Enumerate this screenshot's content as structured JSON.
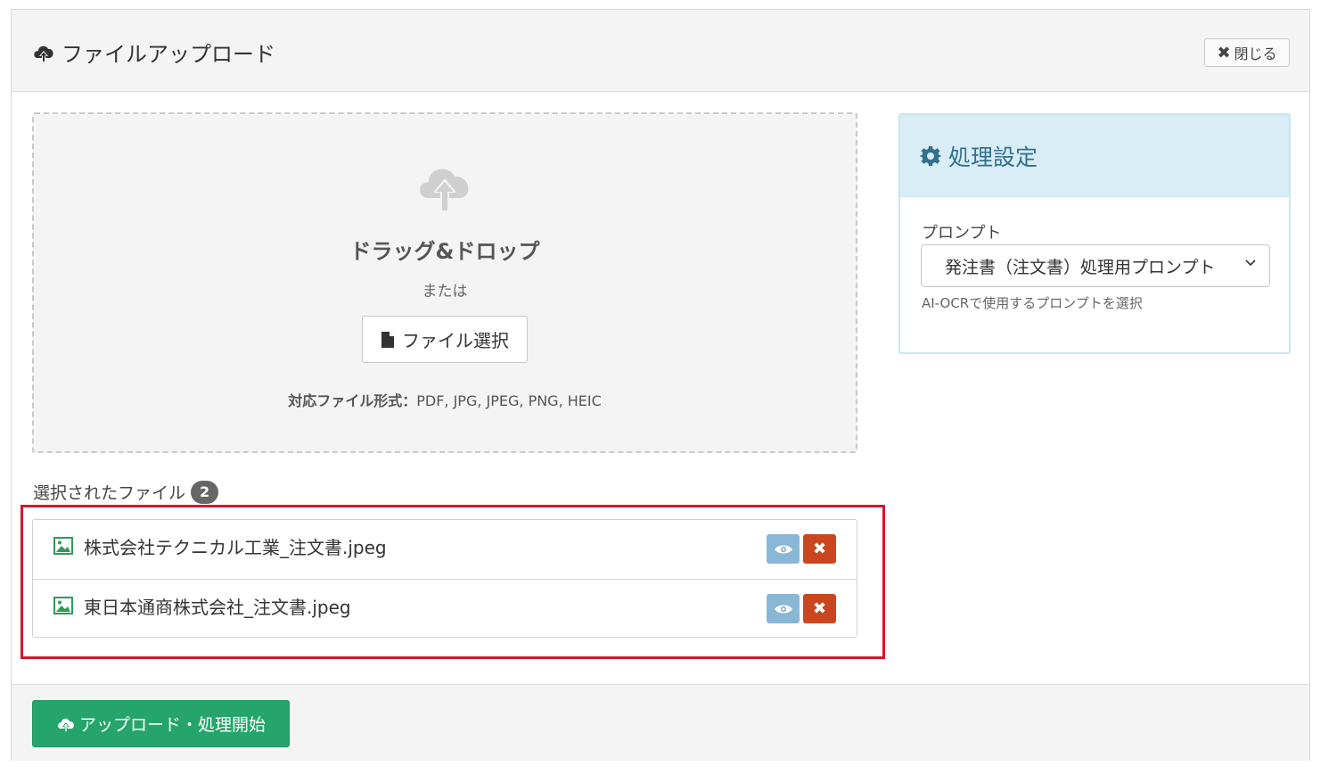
{
  "modal": {
    "title": "ファイルアップロード",
    "close_label": "閉じる"
  },
  "dropzone": {
    "title": "ドラッグ&ドロップ",
    "or_text": "または",
    "file_button_label": "ファイル選択",
    "formats_label": "対応ファイル形式：",
    "formats_value": "PDF, JPG, JPEG, PNG, HEIC"
  },
  "settings": {
    "title": "処理設定",
    "prompt_label": "プロンプト",
    "prompt_selected": "発注書（注文書）処理用プロンプト",
    "prompt_help": "AI-OCRで使用するプロンプトを選択"
  },
  "selected_files": {
    "label": "選択されたファイル",
    "count": "2",
    "files": [
      {
        "name": "株式会社テクニカル工業_注文書.jpeg"
      },
      {
        "name": "東日本通商株式会社_注文書.jpeg"
      }
    ]
  },
  "footer": {
    "start_label": "アップロード・処理開始"
  },
  "colors": {
    "accent_green": "#25a56b",
    "info_blue": "#31708f",
    "danger": "#c9461f",
    "highlight_red": "#d9162a"
  }
}
